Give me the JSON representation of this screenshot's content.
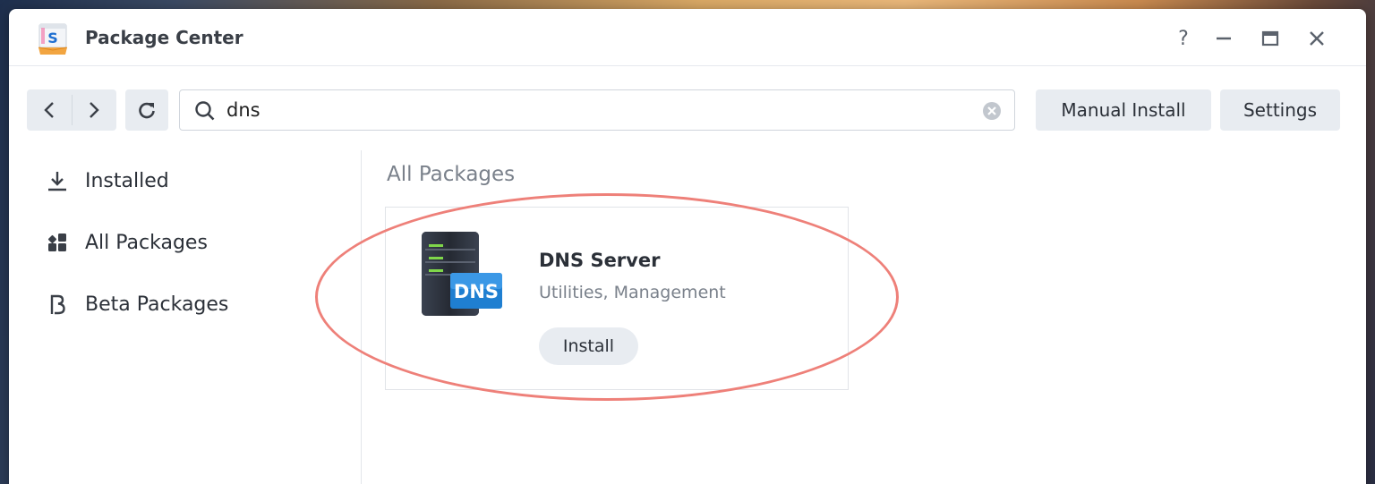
{
  "window": {
    "title": "Package Center",
    "controls": {
      "help": "?",
      "minimize": "—",
      "maximize": "▭",
      "close": "✕"
    }
  },
  "toolbar": {
    "search_value": "dns",
    "manual_install_label": "Manual Install",
    "settings_label": "Settings"
  },
  "sidebar": {
    "items": [
      {
        "label": "Installed",
        "icon": "download-icon"
      },
      {
        "label": "All Packages",
        "icon": "grid-icon"
      },
      {
        "label": "Beta Packages",
        "icon": "beta-icon"
      }
    ]
  },
  "main": {
    "section_title": "All Packages",
    "packages": [
      {
        "name": "DNS Server",
        "category": "Utilities, Management",
        "icon_text": "DNS",
        "install_label": "Install"
      }
    ]
  },
  "colors": {
    "highlight": "#ee8079",
    "button_bg": "#e8ecf1",
    "dns_badge": "#1f7fd1"
  }
}
